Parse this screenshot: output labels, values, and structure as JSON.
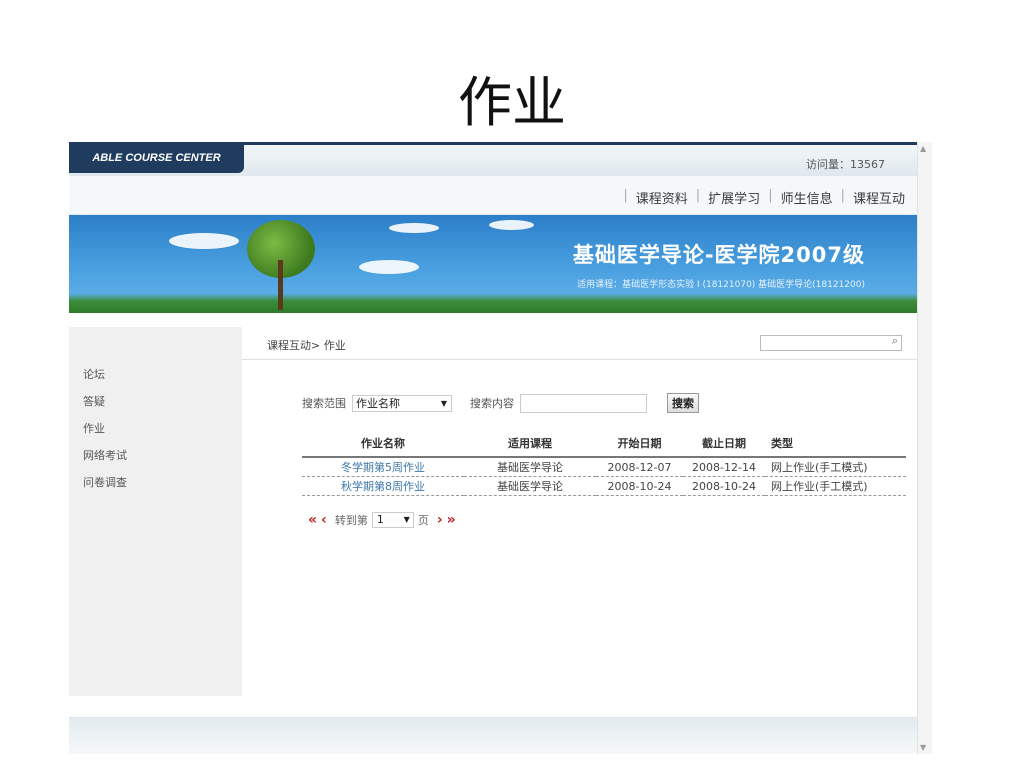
{
  "slide_title": "作业",
  "header": {
    "logo": "ABLE COURSE CENTER",
    "visits": "访问量：13567"
  },
  "nav": [
    "课程资料",
    "扩展学习",
    "师生信息",
    "课程互动"
  ],
  "banner": {
    "title": "基础医学导论-医学院2007级",
    "subtitle": "适用课程：基础医学形态实验 I (18121070) 基础医学导论(18121200)"
  },
  "sidebar": {
    "items": [
      "论坛",
      "答疑",
      "作业",
      "网络考试",
      "问卷调查"
    ]
  },
  "breadcrumb": "课程互动> 作业",
  "filter": {
    "scope_label": "搜索范围",
    "scope_value": "作业名称",
    "content_label": "搜索内容",
    "content_value": "",
    "search_button": "搜索"
  },
  "table": {
    "headers": [
      "作业名称",
      "适用课程",
      "开始日期",
      "截止日期",
      "类型"
    ],
    "rows": [
      [
        "冬学期第5周作业",
        "基础医学导论",
        "2008-12-07",
        "2008-12-14",
        "网上作业(手工模式)"
      ],
      [
        "秋学期第8周作业",
        "基础医学导论",
        "2008-10-24",
        "2008-10-24",
        "网上作业(手工模式)"
      ]
    ]
  },
  "pager": {
    "goto_label": "转到第",
    "page": "1",
    "page_unit": "页"
  },
  "colors": {
    "brand_dark": "#1f3c5e",
    "link": "#3d78a8",
    "pager_arrow": "#c02020"
  }
}
